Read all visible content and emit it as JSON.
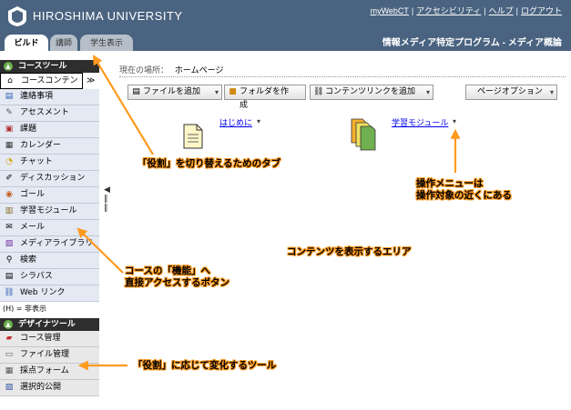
{
  "header": {
    "university": "HIROSHIMA UNIVERSITY",
    "links": [
      "myWebCT",
      "アクセシビリティ",
      "ヘルプ",
      "ログアウト"
    ],
    "course_title": "情報メディア特定プログラム - メディア概論"
  },
  "tabs": [
    "ビルド",
    "講師",
    "学生表示"
  ],
  "sidebar": {
    "course_tools_title": "コースツール",
    "items": [
      {
        "label": "コースコンテンツ",
        "icon": "home-icon"
      },
      {
        "label": "連絡事項",
        "icon": "announcement-icon"
      },
      {
        "label": "アセスメント",
        "icon": "assessment-icon"
      },
      {
        "label": "課題",
        "icon": "assignment-icon"
      },
      {
        "label": "カレンダー",
        "icon": "calendar-icon"
      },
      {
        "label": "チャット",
        "icon": "chat-icon"
      },
      {
        "label": "ディスカッション",
        "icon": "discussion-icon"
      },
      {
        "label": "ゴール",
        "icon": "goal-icon"
      },
      {
        "label": "学習モジュール",
        "icon": "module-icon"
      },
      {
        "label": "メール",
        "icon": "mail-icon"
      },
      {
        "label": "メディアライブラリ",
        "icon": "media-library-icon"
      },
      {
        "label": "検索",
        "icon": "search-icon"
      },
      {
        "label": "シラバス",
        "icon": "syllabus-icon"
      },
      {
        "label": "Web リンク",
        "icon": "web-link-icon"
      }
    ],
    "hidden_note": "(H) = 非表示",
    "designer_tools_title": "デザイナツール",
    "designer_items": [
      {
        "label": "コース管理",
        "icon": "course-manage-icon"
      },
      {
        "label": "ファイル管理",
        "icon": "file-manage-icon"
      },
      {
        "label": "採点フォーム",
        "icon": "grade-form-icon"
      },
      {
        "label": "選択的公開",
        "icon": "selective-release-icon"
      }
    ]
  },
  "breadcrumb": {
    "label": "現在の場所：",
    "value": "ホームページ"
  },
  "toolbar": {
    "add_file": "ファイルを追加",
    "create_folder": "フォルダを作成",
    "add_link": "コンテンツリンクを追加",
    "page_options": "ページオプション"
  },
  "content": {
    "item1": "はじめに",
    "item2": "学習モジュール"
  },
  "annotations": {
    "tabs_note": "「役割」を切り替えるためのタブ",
    "menu_note_1": "操作メニューは",
    "menu_note_2": "操作対象の近くにある",
    "area_note": "コンテンツを表示するエリア",
    "feature_note_1": "コースの「機能」へ",
    "feature_note_2": "直接アクセスするボタン",
    "tools_note": "「役割」に応じて変化するツール"
  },
  "colors": {
    "header_bg": "#4a6380",
    "annotation": "#ff9a1f",
    "link": "#0000ee"
  }
}
